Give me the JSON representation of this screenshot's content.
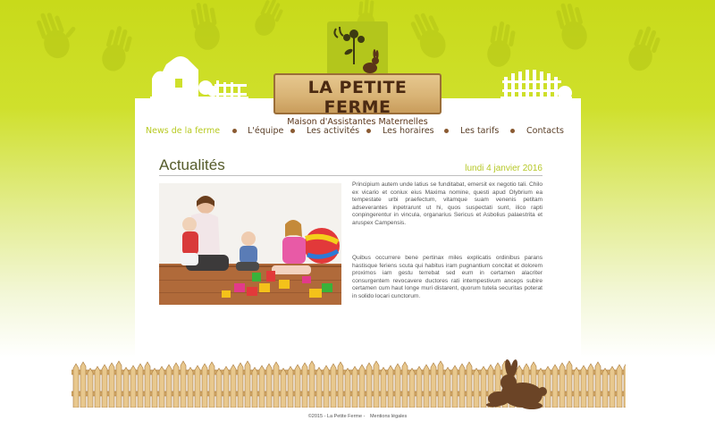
{
  "brand": {
    "title": "LA PETITE FERME",
    "subtitle": "Maison d'Assistantes Maternelles"
  },
  "nav": {
    "items": [
      {
        "label": "News de la ferme",
        "active": true
      },
      {
        "label": "L'équipe"
      },
      {
        "label": "Les activités"
      },
      {
        "label": "Les horaires"
      },
      {
        "label": "Les tarifs"
      },
      {
        "label": "Contacts"
      }
    ]
  },
  "content": {
    "title": "Actualités",
    "date": "lundi 4 janvier 2016",
    "paragraphs": [
      "Principium autem unde latius se funditabat, emersit ex negotio tali. Chilo ex vicario et coniux eius Maxima nomine, questi apud Olybrium ea tempestate urbi praefectum, vitamque suam venenis petitam adseverantes inpetrarunt ut hi, quos suspectati sunt, ilico rapti conpingerentur in vincula, organarius Sericus et Asbolius palaestrita et aruspex Campensis.",
      "Quibus occurrere bene pertinax miles explicatis ordinibus parans hastisque feriens scuta qui habitus iram pugnantium concitat et dolorem proximos iam gestu terrebat sed eum in certamen alacriter consurgentem revocavere ductores rati intempestivum anceps subire certamen cum haut longe muri distarent, quorum tutela securitas poterat in solido locari cunctorum."
    ]
  },
  "footer": {
    "copyright": "©2015 - La Petite Ferme -",
    "legal_link": "Mentions légales"
  },
  "colors": {
    "lime": "#c8da1a",
    "nav_active": "#b8ca22",
    "wood": "#d9b476",
    "brown": "#6b4426"
  }
}
